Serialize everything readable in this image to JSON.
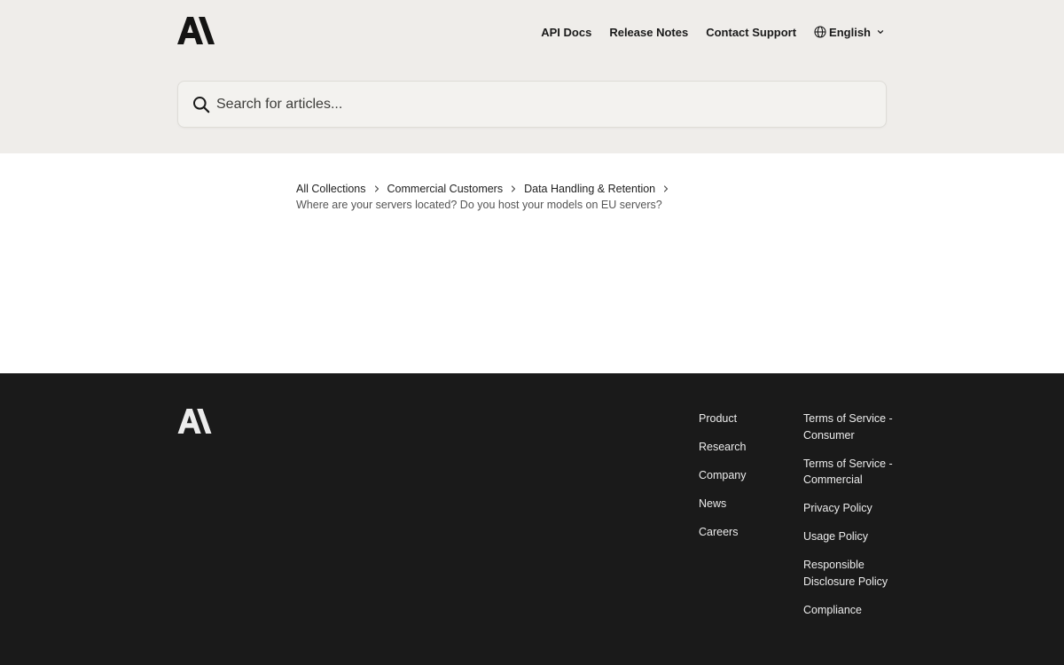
{
  "brand": {
    "logo_icon": "anthropic-logo-icon",
    "accent": "#1a1a1a",
    "header_bg": "#efedea",
    "footer_bg": "#1a1a1a"
  },
  "nav": {
    "links": [
      "API Docs",
      "Release Notes",
      "Contact Support"
    ],
    "language": {
      "label": "English",
      "icon": "globe-icon"
    }
  },
  "search": {
    "placeholder": "Search for articles...",
    "icon": "search-icon",
    "value": ""
  },
  "breadcrumb": {
    "items": [
      "All Collections",
      "Commercial Customers",
      "Data Handling & Retention"
    ],
    "current": "Where are your servers located? Do you host your models on EU servers?"
  },
  "footer": {
    "col1": [
      "Product",
      "Research",
      "Company",
      "News",
      "Careers"
    ],
    "col2": [
      "Terms of Service - Consumer",
      "Terms of Service - Commercial",
      "Privacy Policy",
      "Usage Policy",
      "Responsible Disclosure Policy",
      "Compliance"
    ]
  }
}
